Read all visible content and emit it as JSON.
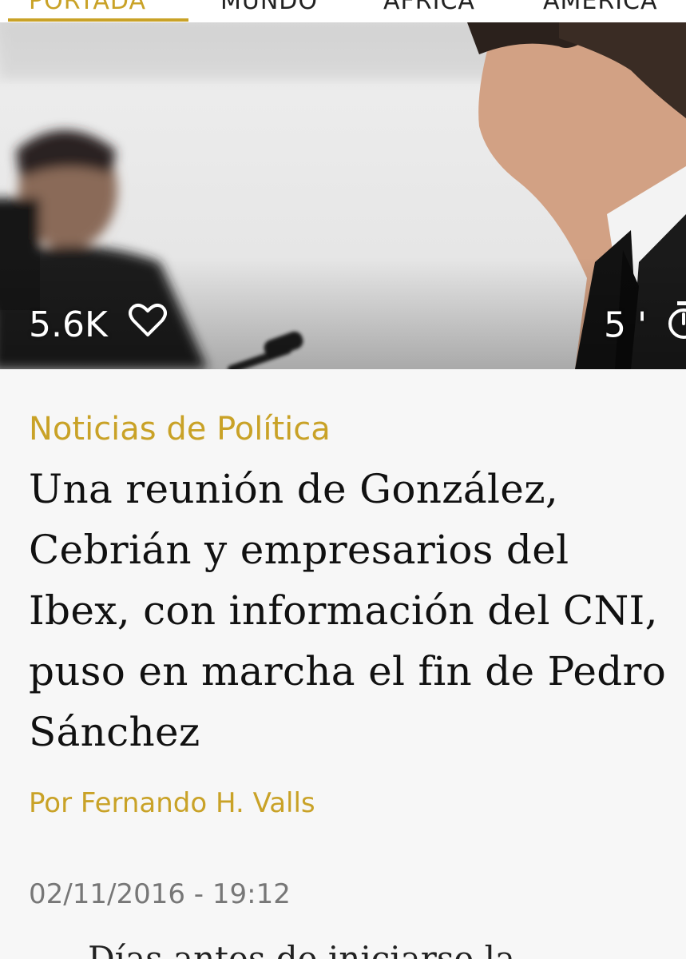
{
  "nav": {
    "tabs": [
      {
        "label": "PORTADA",
        "active": true
      },
      {
        "label": "MUNDO",
        "active": false
      },
      {
        "label": "ÁFRICA",
        "active": false
      },
      {
        "label": "AMÉRICA",
        "active": false
      }
    ]
  },
  "hero": {
    "likes": "5.6K",
    "read_time": "5 '",
    "icons": [
      "heart-icon",
      "timer-icon"
    ]
  },
  "article": {
    "section": "Noticias de Política",
    "headline": "Una reunión de González, Cebrián y empresarios del Ibex, con información del CNI, puso en marcha el fin de Pedro Sánchez",
    "byline": "Por Fernando H. Valls",
    "date": "02/11/2016 - 19:12",
    "body_first_line": "Días antes de iniciarse la"
  },
  "colors": {
    "accent": "#c9a227",
    "text": "#111111",
    "muted": "#777777",
    "background": "#f7f7f7"
  }
}
